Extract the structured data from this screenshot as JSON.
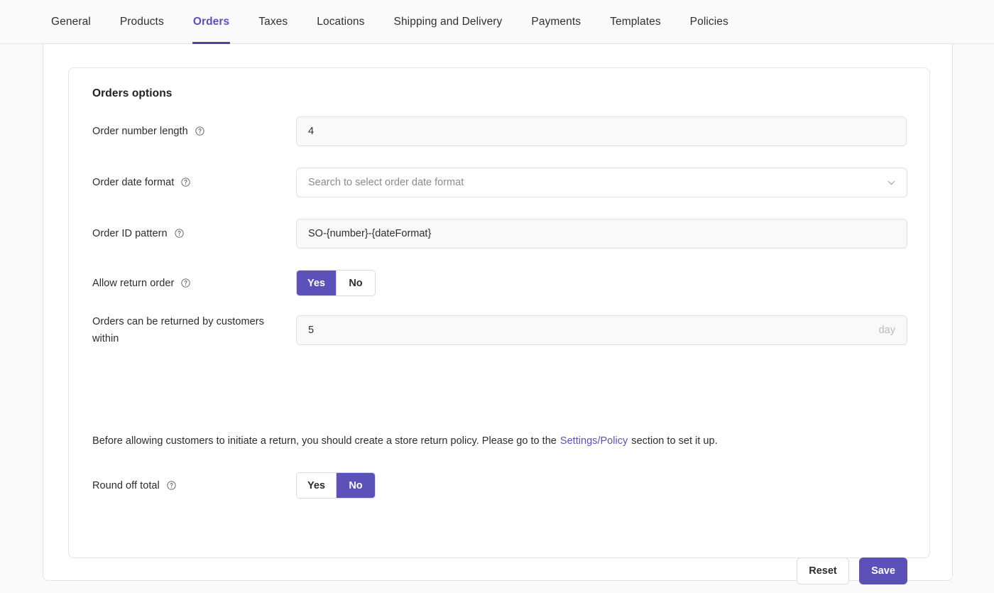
{
  "tabs": [
    {
      "label": "General",
      "active": false
    },
    {
      "label": "Products",
      "active": false
    },
    {
      "label": "Orders",
      "active": true
    },
    {
      "label": "Taxes",
      "active": false
    },
    {
      "label": "Locations",
      "active": false
    },
    {
      "label": "Shipping and Delivery",
      "active": false
    },
    {
      "label": "Payments",
      "active": false
    },
    {
      "label": "Templates",
      "active": false
    },
    {
      "label": "Policies",
      "active": false
    }
  ],
  "card": {
    "title": "Orders options"
  },
  "fields": {
    "order_number_length": {
      "label": "Order number length",
      "value": "4",
      "help_icon": "question-circle-icon"
    },
    "order_date_format": {
      "label": "Order date format",
      "placeholder": "Search to select order date format",
      "value": "",
      "help_icon": "question-circle-icon",
      "dropdown_icon": "chevron-down-icon"
    },
    "order_id_pattern": {
      "label": "Order ID pattern",
      "value": "SO-{number}-{dateFormat}",
      "help_icon": "question-circle-icon"
    },
    "allow_return_order": {
      "label": "Allow return order",
      "help_icon": "question-circle-icon",
      "options": [
        "Yes",
        "No"
      ],
      "selected": "Yes"
    },
    "return_window": {
      "label": "Orders can be returned by customers within",
      "value": "5",
      "suffix": "day"
    },
    "round_off_total": {
      "label": "Round off total",
      "help_icon": "question-circle-icon",
      "options": [
        "Yes",
        "No"
      ],
      "selected": "No"
    }
  },
  "notice": {
    "text_before": "Before allowing customers to initiate a return, you should create a store return policy. Please go to the",
    "link_text": "Settings/Policy",
    "text_after": "section to set it up."
  },
  "footer": {
    "reset_label": "Reset",
    "save_label": "Save"
  },
  "colors": {
    "accent": "#5b51b8",
    "tab_underline": "#4a43a0",
    "page_bg": "#fafafa",
    "card_bg": "#ffffff",
    "field_bg": "#f9f9fa",
    "border": "#e2e2e5",
    "muted_text": "#8b8b98"
  }
}
